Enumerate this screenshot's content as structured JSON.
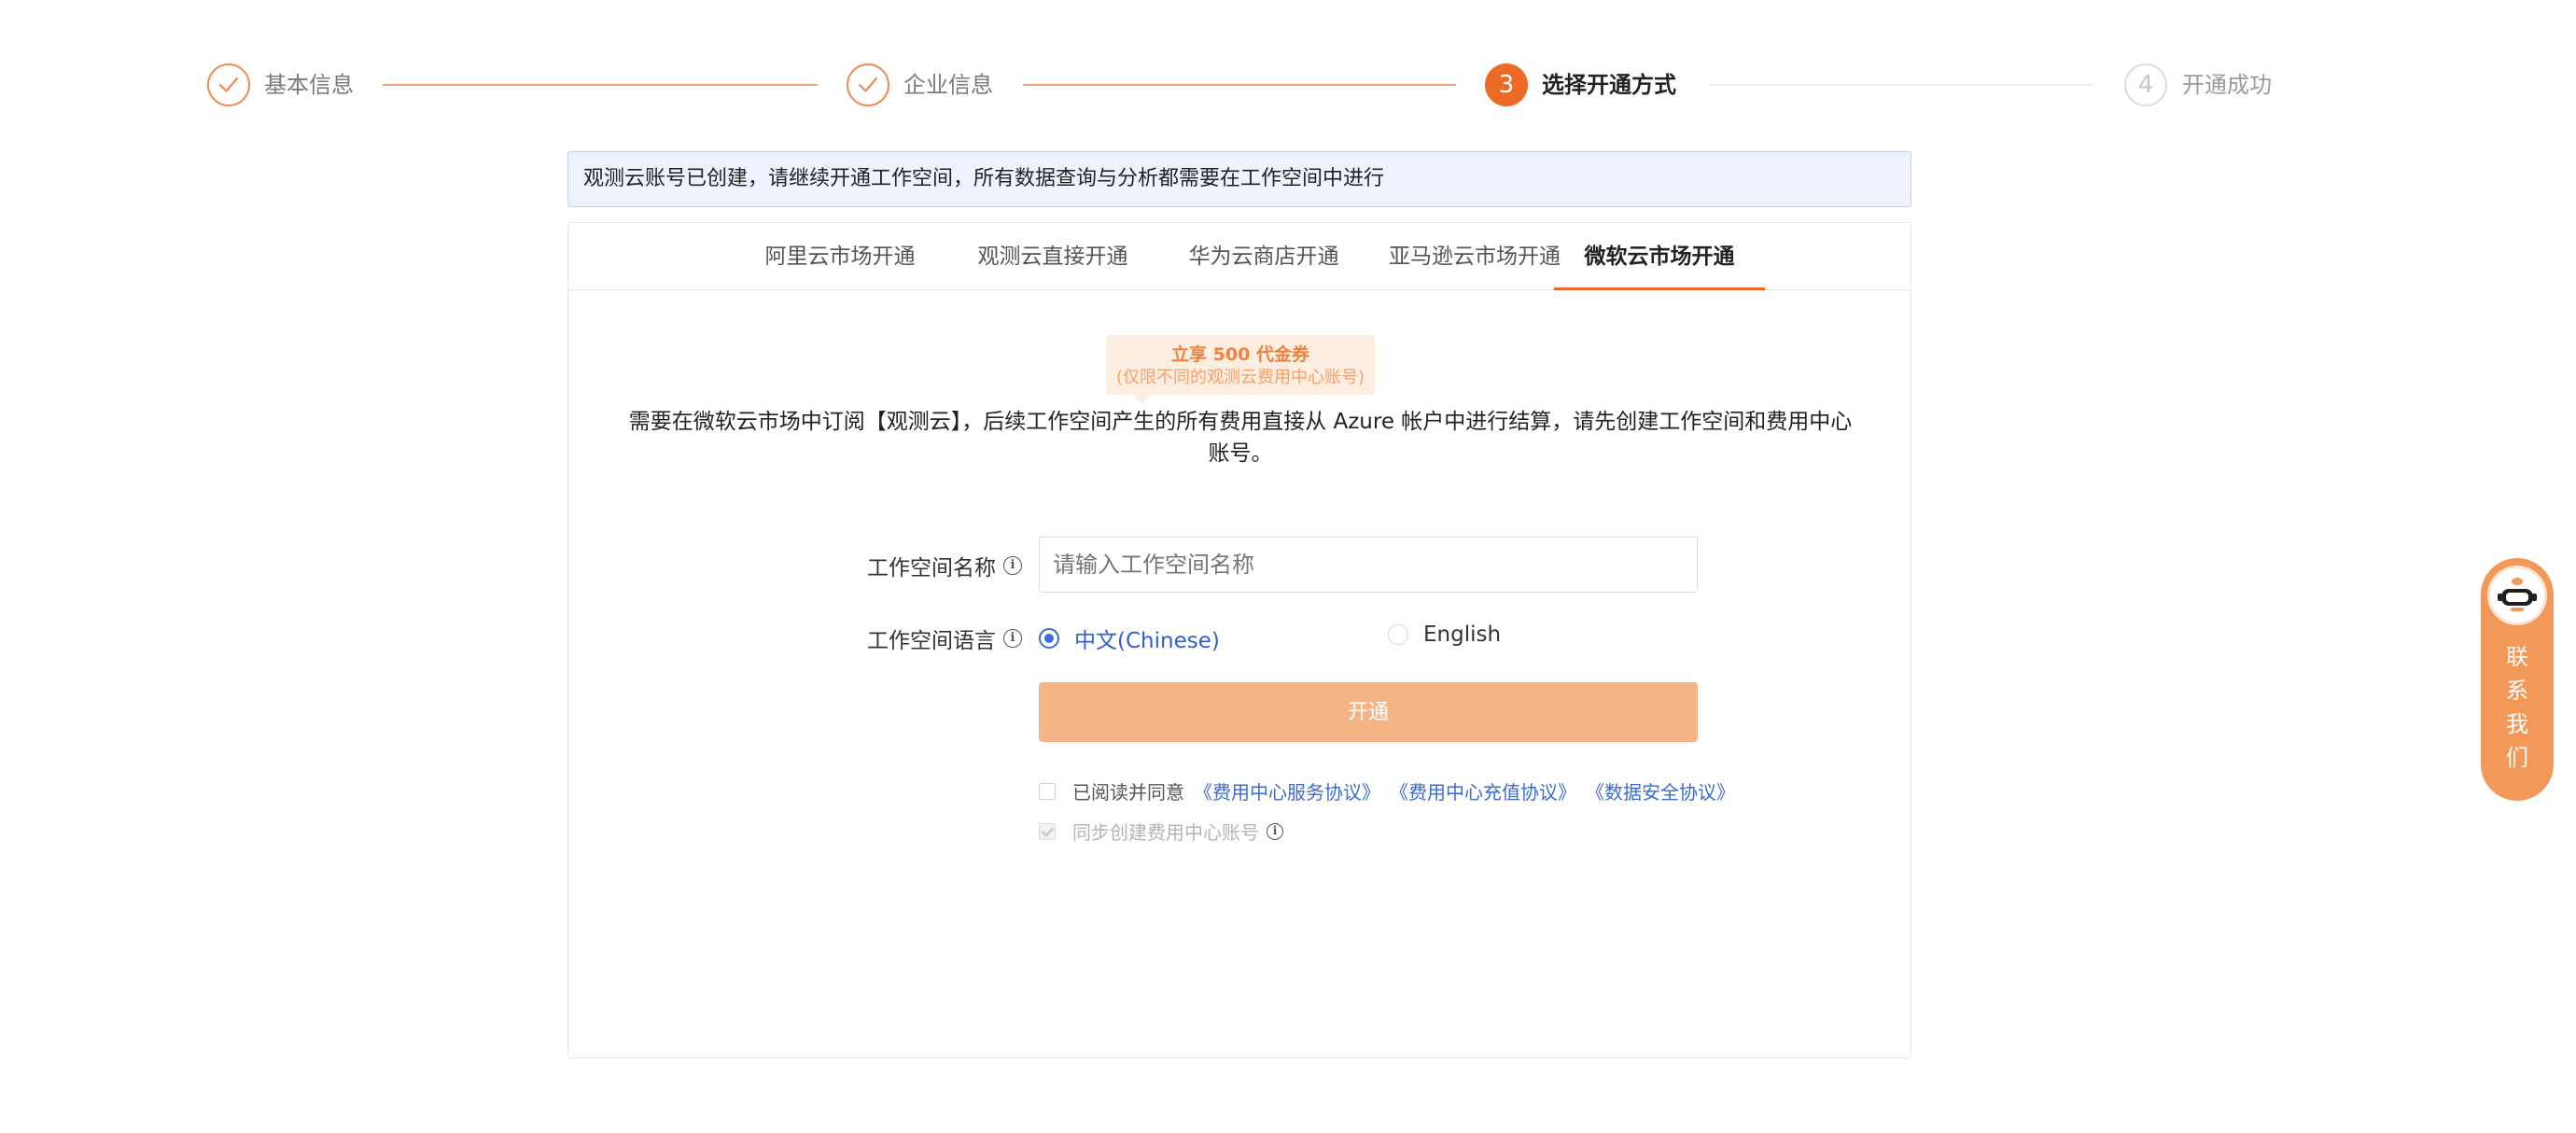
{
  "steps": [
    {
      "label": "基本信息",
      "status": "done"
    },
    {
      "label": "企业信息",
      "status": "done"
    },
    {
      "number": "3",
      "label": "选择开通方式",
      "status": "active"
    },
    {
      "number": "4",
      "label": "开通成功",
      "status": "todo"
    }
  ],
  "notice": "观测云账号已创建，请继续开通工作空间，所有数据查询与分析都需要在工作空间中进行",
  "tabs": [
    {
      "label": "阿里云市场开通"
    },
    {
      "label": "观测云直接开通"
    },
    {
      "label": "华为云商店开通"
    },
    {
      "label": "亚马逊云市场开通"
    },
    {
      "label": "微软云市场开通",
      "active": true
    }
  ],
  "promo": {
    "main": "立享 500 代金券",
    "sub": "(仅限不同的观测云费用中心账号)"
  },
  "description": "需要在微软云市场中订阅【观测云】，后续工作空间产生的所有费用直接从 Azure 帐户中进行结算，请先创建工作空间和费用中心账号。",
  "form": {
    "workspace_name_label": "工作空间名称",
    "workspace_name_placeholder": "请输入工作空间名称",
    "workspace_name_value": "",
    "workspace_lang_label": "工作空间语言",
    "lang_options": [
      {
        "label": "中文(Chinese)",
        "checked": true
      },
      {
        "label": "English",
        "checked": false
      }
    ],
    "submit_label": "开通",
    "agree_prefix": "已阅读并同意",
    "agreements": [
      "《费用中心服务协议》",
      "《费用中心充值协议》",
      "《数据安全协议》"
    ],
    "agree_checked": false,
    "sync_label": "同步创建费用中心账号",
    "sync_checked": true,
    "sync_disabled": true
  },
  "icons": {
    "check": "check-icon",
    "info": "info-icon",
    "avatar": "robot-avatar-icon"
  },
  "contact": {
    "chars": [
      "联",
      "系",
      "我",
      "们"
    ]
  },
  "colors": {
    "accent": "#ec6a25",
    "accent_light": "#f4b485",
    "link": "#3a6ad6",
    "notice_bg": "#edf2fd"
  }
}
